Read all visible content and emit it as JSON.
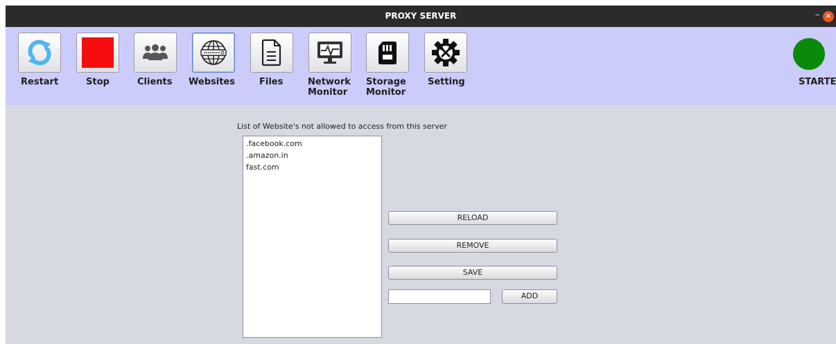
{
  "window": {
    "title": "PROXY SERVER",
    "minimize_glyph": "–",
    "close_glyph": "×"
  },
  "toolbar": {
    "items": [
      {
        "label": "Restart",
        "icon": "refresh-icon"
      },
      {
        "label": "Stop",
        "icon": "stop-icon"
      },
      {
        "label": "Clients",
        "icon": "users-icon"
      },
      {
        "label": "Websites",
        "icon": "globe-icon",
        "active": true
      },
      {
        "label": "Files",
        "icon": "document-icon"
      },
      {
        "label": "Network\nMonitor",
        "icon": "monitor-pulse-icon"
      },
      {
        "label": "Storage\nMonitor",
        "icon": "sd-card-icon"
      },
      {
        "label": "Setting",
        "icon": "gear-tools-icon"
      }
    ]
  },
  "status": {
    "label": "STARTED",
    "color": "#0a8a0a"
  },
  "websites": {
    "caption": "List of Website's not allowed to access from this server",
    "items": [
      ".facebook.com",
      ".amazon.in",
      "fast.com"
    ],
    "reload_label": "RELOAD",
    "remove_label": "REMOVE",
    "save_label": "SAVE",
    "add_label": "ADD",
    "new_site_value": ""
  },
  "colors": {
    "toolbar_bg": "#ccccfb",
    "content_bg": "#d6d9e1",
    "titlebar_bg": "#2b2b2b",
    "refresh_icon": "#4eb6ee",
    "stop_icon": "#f50d10",
    "close_button": "#e95420"
  }
}
